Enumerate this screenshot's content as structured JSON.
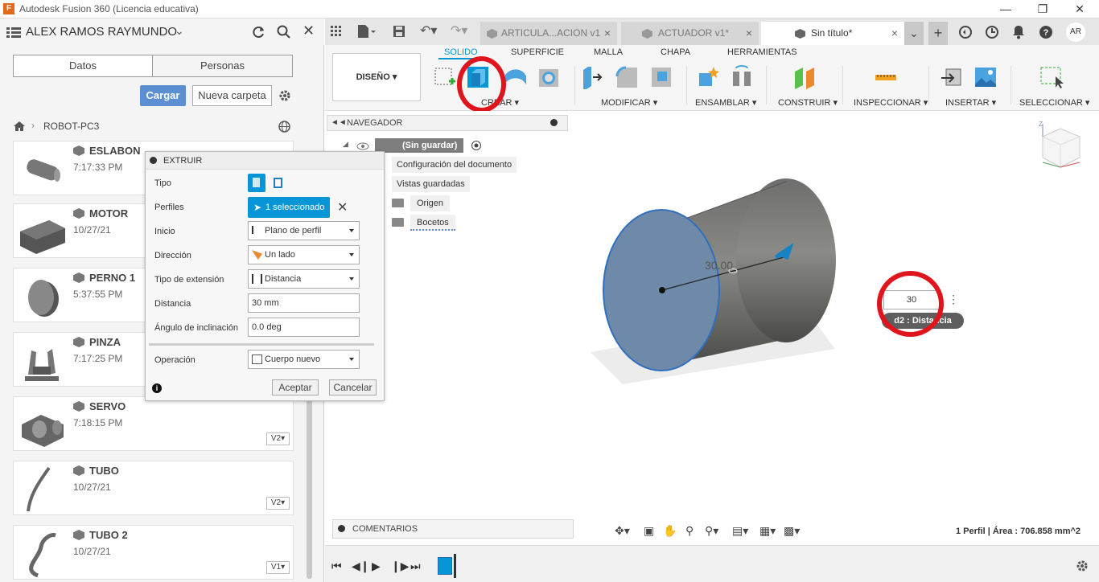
{
  "window": {
    "title": "Autodesk Fusion 360 (Licencia educativa)"
  },
  "left_panel": {
    "user": "ALEX RAMOS RAYMUNDO",
    "tabs": [
      "Datos",
      "Personas"
    ],
    "upload_label": "Cargar",
    "new_folder_label": "Nueva carpeta",
    "breadcrumb_project": "ROBOT-PC3",
    "files": [
      {
        "name": "ESLABON",
        "time": "7:17:33 PM",
        "version": ""
      },
      {
        "name": "MOTOR",
        "time": "10/27/21",
        "version": ""
      },
      {
        "name": "PERNO 1",
        "time": "5:37:55 PM",
        "version": ""
      },
      {
        "name": "PINZA",
        "time": "7:17:25 PM",
        "version": ""
      },
      {
        "name": "SERVO",
        "time": "7:18:15 PM",
        "version": "V2▾"
      },
      {
        "name": "TUBO",
        "time": "10/27/21",
        "version": "V2▾"
      },
      {
        "name": "TUBO 2",
        "time": "10/27/21",
        "version": "V1▾"
      }
    ]
  },
  "extrude": {
    "title": "EXTRUIR",
    "tipo_label": "Tipo",
    "perfiles_label": "Perfiles",
    "perfiles_value": "1 seleccionado",
    "inicio_label": "Inicio",
    "inicio_value": "Plano de perfil",
    "direccion_label": "Dirección",
    "direccion_value": "Un lado",
    "tipo_ext_label": "Tipo de extensión",
    "tipo_ext_value": "Distancia",
    "distancia_label": "Distancia",
    "distancia_value": "30 mm",
    "angulo_label": "Ángulo de inclinación",
    "angulo_value": "0.0 deg",
    "operacion_label": "Operación",
    "operacion_value": "Cuerpo nuevo",
    "ok_label": "Aceptar",
    "cancel_label": "Cancelar"
  },
  "doc_tabs": [
    {
      "label": "ARTICULA...ACION v1"
    },
    {
      "label": "ACTUADOR v1*"
    },
    {
      "label": "Sin título*"
    }
  ],
  "avatar": "AR",
  "toolbar": {
    "workspace": "DISEÑO ▾",
    "tabs": [
      "SOLIDO",
      "SUPERFICIE",
      "MALLA",
      "CHAPA",
      "HERRAMIENTAS"
    ],
    "groups": [
      "CREAR ▾",
      "MODIFICAR ▾",
      "ENSAMBLAR ▾",
      "CONSTRUIR ▾",
      "INSPECCIONAR ▾",
      "INSERTAR ▾",
      "SELECCIONAR ▾"
    ]
  },
  "navigator": {
    "title": "NAVEGADOR",
    "root": "(Sin guardar)",
    "items": [
      "Configuración del documento",
      "Vistas guardadas",
      "Origen",
      "Bocetos"
    ]
  },
  "viewport": {
    "dim_label": "30.00",
    "dim_input": "30",
    "dim_tag": "d2 : Distancia",
    "status": "1 Perfil | Área : 706.858 mm^2"
  },
  "comments_label": "COMENTARIOS",
  "colors": {
    "accent": "#0696d7",
    "highlight_ring": "#e0141d",
    "button_blue": "#5b8fd1"
  }
}
